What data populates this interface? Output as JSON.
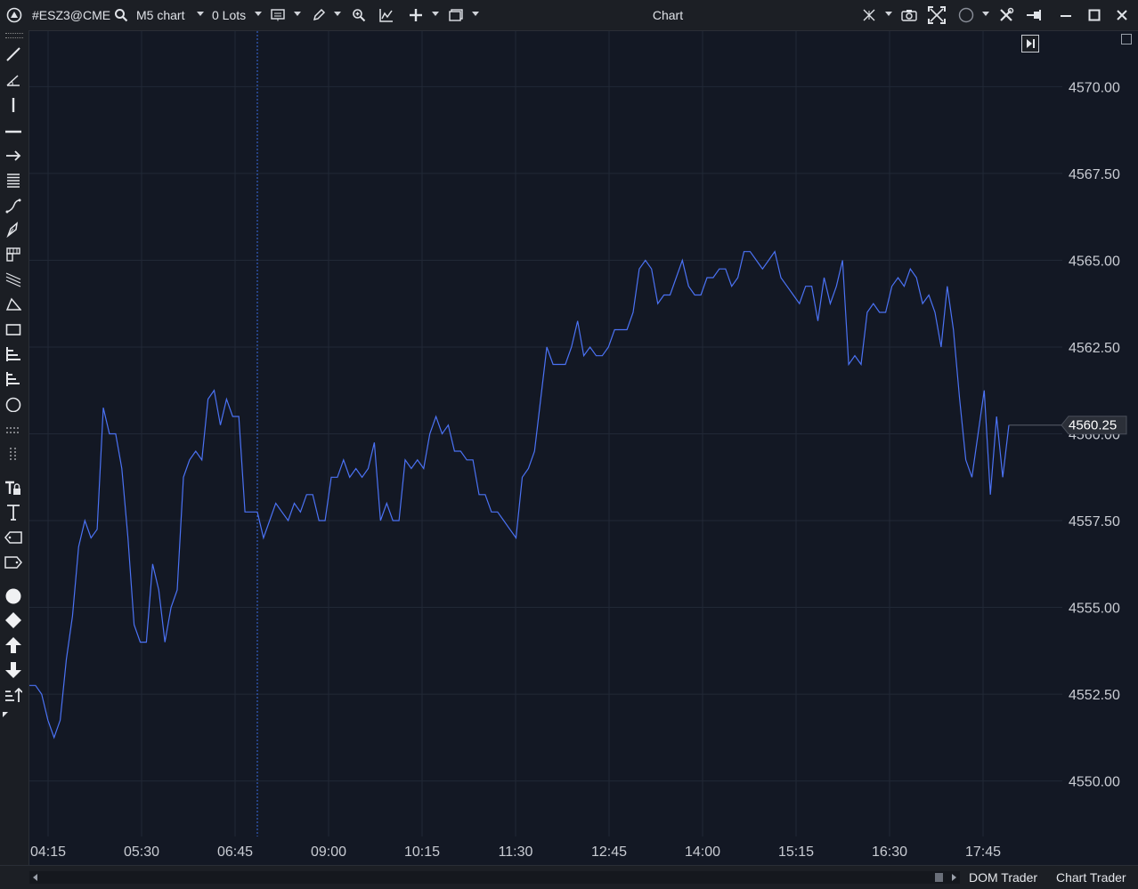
{
  "toolbar": {
    "symbol": "#ESZ3@CME",
    "timeframe": "M5 chart",
    "lots": "0 Lots"
  },
  "window": {
    "title": "Chart"
  },
  "chart_data": {
    "type": "line",
    "x_ticks": [
      "04:15",
      "05:30",
      "06:45",
      "09:00",
      "10:15",
      "11:30",
      "12:45",
      "14:00",
      "15:15",
      "16:30",
      "17:45"
    ],
    "y_ticks": [
      "4570.00",
      "4567.50",
      "4565.00",
      "4562.50",
      "4560.00",
      "4557.50",
      "4555.00",
      "4552.50",
      "4550.00"
    ],
    "ylim": [
      4548.4,
      4571.6
    ],
    "last_price": "4560.25",
    "values": [
      4552.75,
      4552.75,
      4552.5,
      4551.75,
      4551.25,
      4551.75,
      4553.5,
      4554.75,
      4556.75,
      4557.5,
      4557.0,
      4557.25,
      4560.75,
      4560.0,
      4560.0,
      4559.0,
      4557.0,
      4554.5,
      4554.0,
      4554.0,
      4556.25,
      4555.5,
      4554.0,
      4555.0,
      4555.5,
      4558.75,
      4559.25,
      4559.5,
      4559.25,
      4561.0,
      4561.25,
      4560.25,
      4561.0,
      4560.5,
      4560.5,
      4557.75,
      4557.75,
      4557.75,
      4557.0,
      4557.5,
      4558.0,
      4557.75,
      4557.5,
      4558.0,
      4557.75,
      4558.25,
      4558.25,
      4557.5,
      4557.5,
      4558.75,
      4558.75,
      4559.25,
      4558.75,
      4559.0,
      4558.75,
      4559.0,
      4559.75,
      4557.5,
      4558.0,
      4557.5,
      4557.5,
      4559.25,
      4559.0,
      4559.25,
      4559.0,
      4560.0,
      4560.5,
      4560.0,
      4560.25,
      4559.5,
      4559.5,
      4559.25,
      4559.25,
      4558.25,
      4558.25,
      4557.75,
      4557.75,
      4557.5,
      4557.25,
      4557.0,
      4558.75,
      4559.0,
      4559.5,
      4561.0,
      4562.5,
      4562.0,
      4562.0,
      4562.0,
      4562.5,
      4563.25,
      4562.25,
      4562.5,
      4562.25,
      4562.25,
      4562.5,
      4563.0,
      4563.0,
      4563.0,
      4563.5,
      4564.75,
      4565.0,
      4564.75,
      4563.75,
      4564.0,
      4564.0,
      4564.5,
      4565.0,
      4564.25,
      4564.0,
      4564.0,
      4564.5,
      4564.5,
      4564.75,
      4564.75,
      4564.25,
      4564.5,
      4565.25,
      4565.25,
      4565.0,
      4564.75,
      4565.0,
      4565.25,
      4564.5,
      4564.25,
      4564.0,
      4563.75,
      4564.25,
      4564.25,
      4563.25,
      4564.5,
      4563.75,
      4564.25,
      4565.0,
      4562.0,
      4562.25,
      4562.0,
      4563.5,
      4563.75,
      4563.5,
      4563.5,
      4564.25,
      4564.5,
      4564.25,
      4564.75,
      4564.5,
      4563.75,
      4564.0,
      4563.5,
      4562.5,
      4564.25,
      4563.0,
      4561.0,
      4559.25,
      4558.75,
      4560.0,
      4561.25,
      4558.25,
      4560.5,
      4558.75,
      4560.25
    ]
  },
  "bottom": {
    "tab1": "DOM Trader",
    "tab2": "Chart Trader"
  }
}
